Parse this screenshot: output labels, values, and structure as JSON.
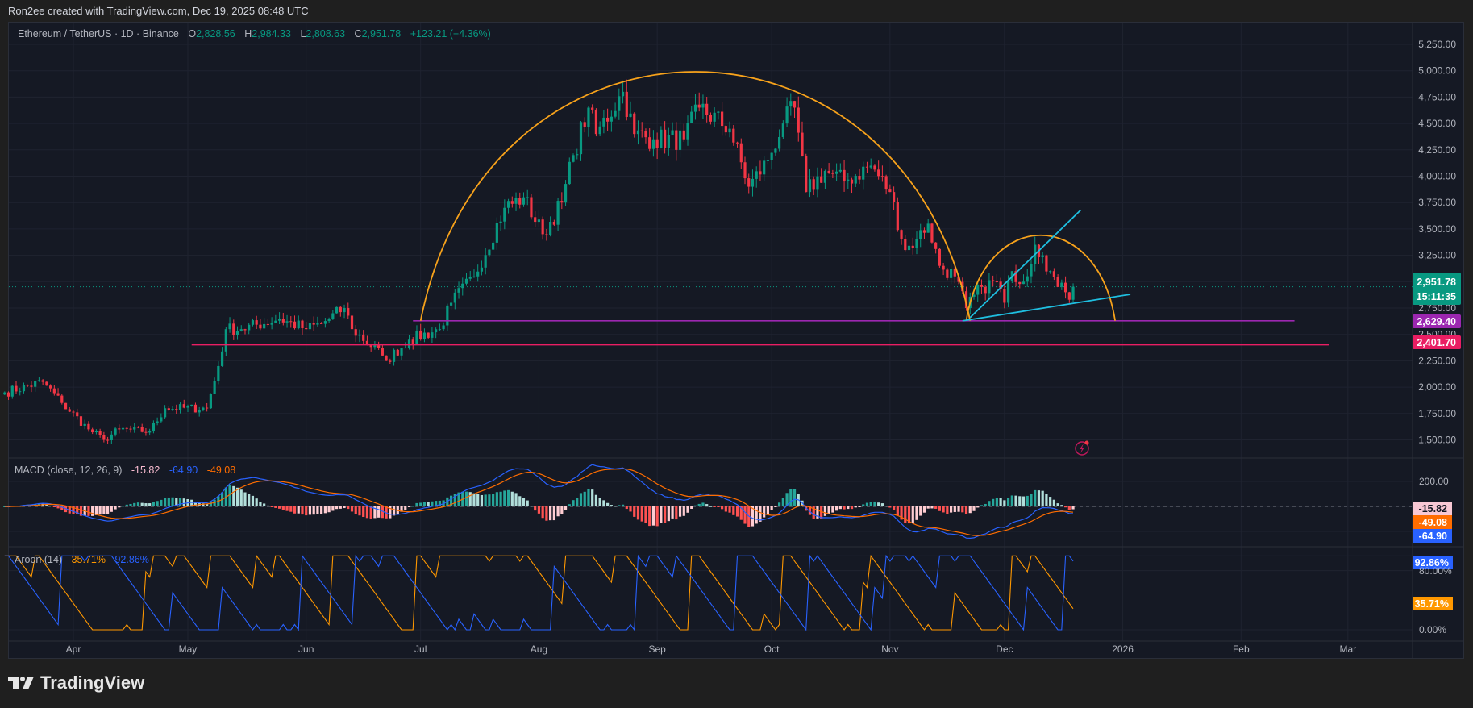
{
  "top_note": "Ron2ee created with TradingView.com, Dec 19, 2025 08:48 UTC",
  "legend": {
    "symbol": "Ethereum / TetherUS · 1D · Binance",
    "o_label": "O",
    "o": "2,828.56",
    "h_label": "H",
    "h": "2,984.33",
    "l_label": "L",
    "l": "2,808.63",
    "c_label": "C",
    "c": "2,951.78",
    "change": "+123.21 (+4.36%)"
  },
  "macd_legend": {
    "title": "MACD (close, 12, 26, 9)",
    "hist": "-15.82",
    "macd": "-64.90",
    "signal": "-49.08"
  },
  "aroon_legend": {
    "title": "Aroon (14)",
    "up": "35.71%",
    "down": "92.86%"
  },
  "price_badges": {
    "last": "2,951.78",
    "countdown": "15:11:35",
    "purple": "2,629.40",
    "red": "2,401.70"
  },
  "macd_badges": {
    "hist": "-15.82",
    "signal": "-49.08",
    "macd": "-64.90"
  },
  "aroon_badges": {
    "down": "92.86%",
    "up": "35.71%"
  },
  "logo_text": "TradingView",
  "colors": {
    "up": "#089981",
    "down": "#f23645",
    "arc": "#f7a21b",
    "wedge": "#1fbfe0",
    "support_purple": "#9c27b0",
    "support_red": "#e91e63",
    "macd": "#2962ff",
    "signal": "#ff6d00",
    "aroon_up": "#ff9800",
    "aroon_down": "#2962ff"
  },
  "chart_data": [
    {
      "type": "candlestick",
      "title": "Ethereum / TetherUS · 1D · Binance",
      "y_axis_ticks": [
        "5,250.00",
        "5,000.00",
        "4,750.00",
        "4,500.00",
        "4,250.00",
        "4,000.00",
        "3,750.00",
        "3,500.00",
        "3,250.00",
        "3,000.00",
        "2,750.00",
        "2,500.00",
        "2,250.00",
        "2,000.00",
        "1,750.00",
        "1,500.00"
      ],
      "y_tick_values": [
        5250,
        5000,
        4750,
        4500,
        4250,
        4000,
        3750,
        3500,
        3250,
        3000,
        2750,
        2500,
        2250,
        2000,
        1750,
        1500
      ],
      "x_axis_ticks": [
        {
          "label": "Apr",
          "date": "2025-04-01"
        },
        {
          "label": "May",
          "date": "2025-05-01"
        },
        {
          "label": "Jun",
          "date": "2025-06-01"
        },
        {
          "label": "Jul",
          "date": "2025-07-01"
        },
        {
          "label": "Aug",
          "date": "2025-08-01"
        },
        {
          "label": "Sep",
          "date": "2025-09-01"
        },
        {
          "label": "Oct",
          "date": "2025-10-01"
        },
        {
          "label": "Nov",
          "date": "2025-11-01"
        },
        {
          "label": "Dec",
          "date": "2025-12-01"
        },
        {
          "label": "2026",
          "date": "2026-01-01"
        },
        {
          "label": "Feb",
          "date": "2026-02-01"
        },
        {
          "label": "Mar",
          "date": "2026-03-01"
        }
      ],
      "approx_closes": [
        [
          "2025-03-14",
          1950
        ],
        [
          "2025-03-24",
          2050
        ],
        [
          "2025-03-29",
          1850
        ],
        [
          "2025-04-05",
          1600
        ],
        [
          "2025-04-09",
          1500
        ],
        [
          "2025-04-13",
          1600
        ],
        [
          "2025-04-21",
          1580
        ],
        [
          "2025-04-25",
          1800
        ],
        [
          "2025-05-06",
          1800
        ],
        [
          "2025-05-09",
          2200
        ],
        [
          "2025-05-11",
          2550
        ],
        [
          "2025-05-15",
          2550
        ],
        [
          "2025-05-25",
          2650
        ],
        [
          "2025-06-01",
          2550
        ],
        [
          "2025-06-05",
          2600
        ],
        [
          "2025-06-11",
          2750
        ],
        [
          "2025-06-13",
          2550
        ],
        [
          "2025-06-21",
          2300
        ],
        [
          "2025-06-22",
          2250
        ],
        [
          "2025-06-28",
          2450
        ],
        [
          "2025-07-06",
          2550
        ],
        [
          "2025-07-09",
          2800
        ],
        [
          "2025-07-15",
          3050
        ],
        [
          "2025-07-23",
          3700
        ],
        [
          "2025-07-28",
          3800
        ],
        [
          "2025-08-02",
          3450
        ],
        [
          "2025-08-07",
          3750
        ],
        [
          "2025-08-10",
          4200
        ],
        [
          "2025-08-14",
          4650
        ],
        [
          "2025-08-16",
          4400
        ],
        [
          "2025-08-23",
          4800
        ],
        [
          "2025-08-26",
          4400
        ],
        [
          "2025-08-31",
          4350
        ],
        [
          "2025-09-08",
          4350
        ],
        [
          "2025-09-12",
          4650
        ],
        [
          "2025-09-20",
          4450
        ],
        [
          "2025-09-25",
          3900
        ],
        [
          "2025-09-30",
          4150
        ],
        [
          "2025-10-04",
          4500
        ],
        [
          "2025-10-07",
          4650
        ],
        [
          "2025-10-10",
          3850
        ],
        [
          "2025-10-15",
          4050
        ],
        [
          "2025-10-20",
          3950
        ],
        [
          "2025-10-27",
          4100
        ],
        [
          "2025-11-01",
          3850
        ],
        [
          "2025-11-05",
          3300
        ],
        [
          "2025-11-08",
          3400
        ],
        [
          "2025-11-11",
          3550
        ],
        [
          "2025-11-14",
          3150
        ],
        [
          "2025-11-18",
          3050
        ],
        [
          "2025-11-21",
          2750
        ],
        [
          "2025-11-25",
          2950
        ],
        [
          "2025-11-29",
          3000
        ],
        [
          "2025-12-01",
          2800
        ],
        [
          "2025-12-03",
          3100
        ],
        [
          "2025-12-06",
          3000
        ],
        [
          "2025-12-09",
          3350
        ],
        [
          "2025-12-11",
          3250
        ],
        [
          "2025-12-13",
          3100
        ],
        [
          "2025-12-15",
          2950
        ],
        [
          "2025-12-17",
          2900
        ],
        [
          "2025-12-18",
          2828.56
        ],
        [
          "2025-12-19",
          2951.78
        ]
      ],
      "last_bar": {
        "date": "2025-12-19",
        "open": 2828.56,
        "high": 2984.33,
        "low": 2808.63,
        "close": 2951.78
      },
      "horizontal_lines": [
        {
          "price": 2629.4,
          "from": "2025-06-29",
          "to": "2026-02-15",
          "color": "#9c27b0"
        },
        {
          "price": 2401.7,
          "from": "2025-05-02",
          "to": "2026-02-24",
          "color": "#e91e63"
        }
      ],
      "arcs": [
        {
          "from": "2025-07-01",
          "peak_date": "2025-09-11",
          "peak_price": 4990,
          "to": "2025-11-22",
          "base": 2629.4
        },
        {
          "from": "2025-11-21",
          "peak_date": "2025-12-09",
          "peak_price": 3440,
          "to": "2025-12-30",
          "base": 2629.4
        }
      ],
      "trendlines": [
        {
          "from": [
            "2025-11-20",
            2629
          ],
          "to": [
            "2026-01-03",
            2880
          ]
        },
        {
          "from": [
            "2025-11-22",
            2660
          ],
          "to": [
            "2025-12-21",
            3680
          ]
        }
      ]
    },
    {
      "type": "line",
      "title": "MACD (close, 12, 26, 9)",
      "y_axis_ticks": [
        "200.00"
      ],
      "latest": {
        "histogram": -15.82,
        "macd": -64.9,
        "signal": -49.08
      }
    },
    {
      "type": "line",
      "title": "Aroon (14)",
      "y_axis_ticks": [
        "80.00%",
        "0.00%"
      ],
      "latest": {
        "up": 35.71,
        "down": 92.86
      }
    }
  ]
}
